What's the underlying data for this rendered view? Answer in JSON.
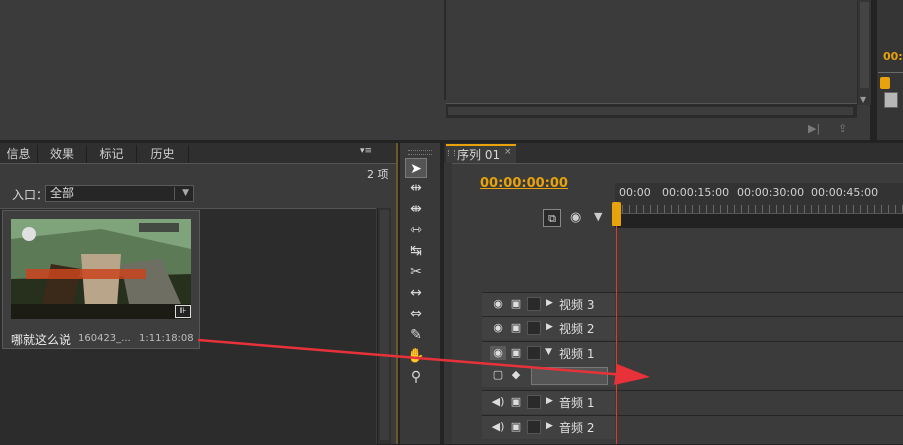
{
  "project_panel": {
    "tabs": [
      "信息",
      "效果",
      "标记",
      "历史"
    ],
    "menu_glyph": "▾≡",
    "item_count": "2 项",
    "entry_label": "入口：",
    "entry_value": "全部",
    "clip": {
      "name": "哪就这么说",
      "id": "160423_...",
      "duration": "1:11:18:08"
    }
  },
  "sequence": {
    "tab_label": "序列 01",
    "tab_close": "×",
    "timecode": "00:00:00:00",
    "ruler_labels": [
      "00:00",
      "00:00:15:00",
      "00:00:30:00",
      "00:00:45:00"
    ],
    "tracks": [
      {
        "name": "视频 3",
        "kind": "video",
        "expanded": false
      },
      {
        "name": "视频 2",
        "kind": "video",
        "expanded": false
      },
      {
        "name": "视频 1",
        "kind": "video",
        "expanded": true
      },
      {
        "name": "音频 1",
        "kind": "audio",
        "expanded": false
      },
      {
        "name": "音频 2",
        "kind": "audio",
        "expanded": false
      }
    ]
  },
  "source_monitor": {
    "timecode_partial": "00:"
  },
  "icons": [
    "eye-icon",
    "speaker-icon",
    "film-icon",
    "lock-icon",
    "selection-tool-icon",
    "hand-tool-icon",
    "zoom-tool-icon",
    "pen-tool-icon",
    "razor-tool-icon"
  ],
  "colors": {
    "accent": "#e8a30c",
    "playhead": "#e03a2a",
    "annotation_arrow": "#e8323a"
  }
}
